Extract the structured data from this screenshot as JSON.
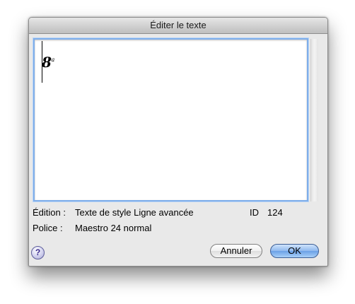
{
  "dialog": {
    "title": "Éditer le texte"
  },
  "editor": {
    "symbol_main": "8",
    "symbol_sup": "va"
  },
  "info": {
    "edition_label": "Édition :",
    "edition_value": "Texte de style Ligne avancée",
    "id_label": "ID",
    "id_value": "124",
    "police_label": "Police :",
    "police_value": "Maestro 24 normal"
  },
  "buttons": {
    "help_label": "?",
    "cancel_label": "Annuler",
    "ok_label": "OK"
  },
  "colors": {
    "focus_ring": "#7faeea",
    "default_button": "#6ba0e6",
    "window_bg": "#e9e9e9"
  }
}
